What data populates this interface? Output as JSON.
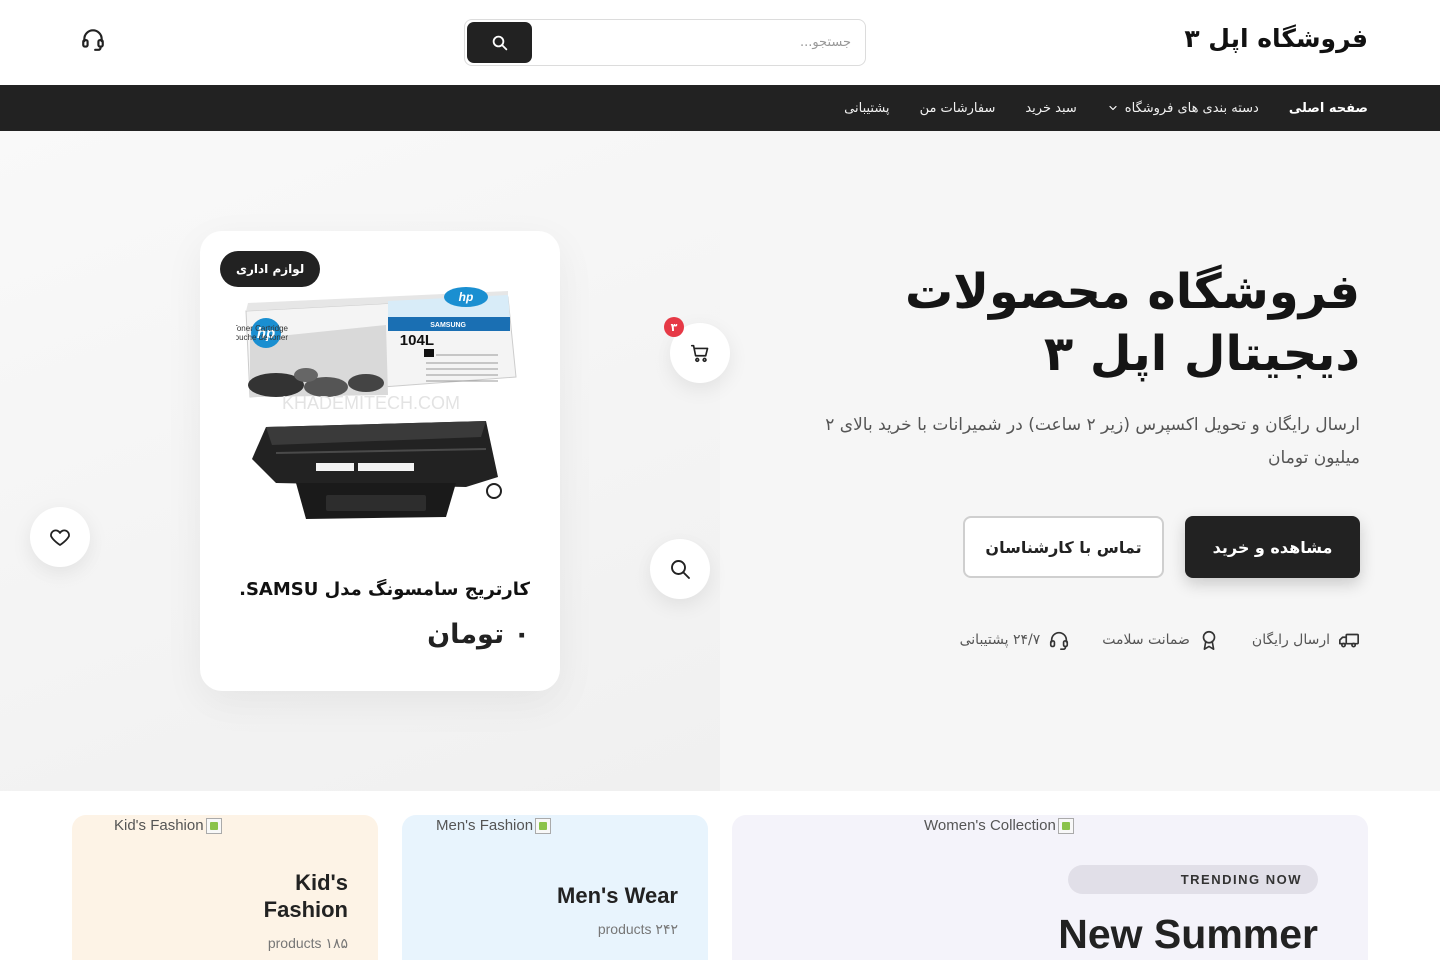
{
  "header": {
    "logo": "فروشگاه اپل ۳",
    "search_placeholder": "جستجو...",
    "support_icon": "headset-icon"
  },
  "nav": {
    "items": [
      {
        "label": "صفحه اصلی"
      },
      {
        "label": "دسته بندی های فروشگاه",
        "has_dropdown": true
      },
      {
        "label": "سبد خرید"
      },
      {
        "label": "سفارشات من"
      },
      {
        "label": "پشتیبانی"
      }
    ]
  },
  "hero": {
    "title_line1": "فروشگاه محصولات",
    "title_line2": "دیجیتال اپل ۳",
    "subtitle": "ارسال رایگان و تحویل اکسپرس (زیر ۲ ساعت) در شمیرانات با خرید بالای ۲ میلیون تومان",
    "primary_button": "مشاهده و خرید",
    "secondary_button": "تماس با کارشناسان",
    "features": [
      {
        "label": "ارسال رایگان",
        "icon": "truck-icon"
      },
      {
        "label": "ضمانت سلامت",
        "icon": "award-icon"
      },
      {
        "label": "۲۴/۷ پشتیبانی",
        "icon": "headset-icon"
      }
    ]
  },
  "product": {
    "badge": "لوازم اداری",
    "name": "کارتریج سامسونگ مدل SAMSU...",
    "price": "۰ تومان",
    "cart_count": "۳",
    "image_watermark": "KHADEMITECH.COM",
    "box_model": "104L",
    "box_text": "Toner Cartridge\nCartouche de toner",
    "box_brand": "SAMSUNG",
    "box_logo": "hp"
  },
  "categories": [
    {
      "alt": "Kid's Fashion",
      "title_line1": "Kid's",
      "title_line2": "Fashion",
      "count": "products ۱۸۵",
      "bg": "#fdf3e6"
    },
    {
      "alt": "Men's Fashion",
      "title": "Men's Wear",
      "count": "products ۲۴۲",
      "bg": "#e8f4fd"
    },
    {
      "alt": "Women's Collection",
      "badge": "TRENDING NOW",
      "title": "New Summer",
      "bg": "#f4f3fa"
    }
  ],
  "colors": {
    "dark": "#222222",
    "badge_red": "#e63946",
    "hero_bg": "#f6f6f6"
  }
}
